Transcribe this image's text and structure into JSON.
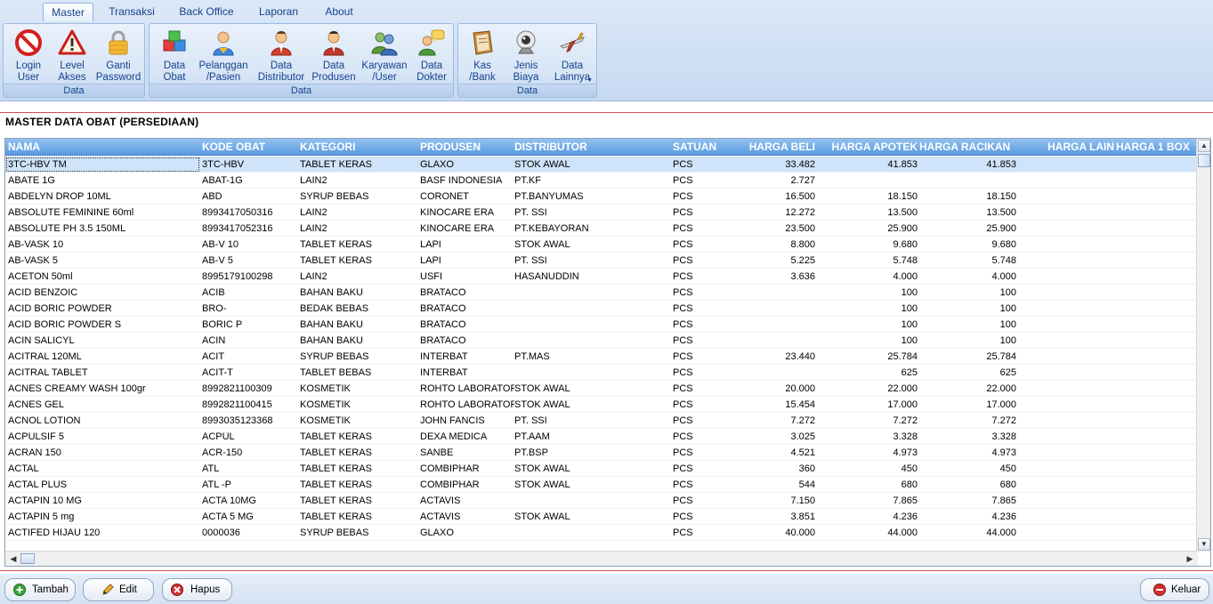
{
  "ribbon": {
    "tabs": [
      {
        "label": "Master",
        "active": true
      },
      {
        "label": "Transaksi",
        "active": false
      },
      {
        "label": "Back Office",
        "active": false
      },
      {
        "label": "Laporan",
        "active": false
      },
      {
        "label": "About",
        "active": false
      }
    ],
    "groups": [
      {
        "label": "Data",
        "buttons": [
          {
            "label": "Login\nUser",
            "icon": "no-entry-icon"
          },
          {
            "label": "Level\nAkses",
            "icon": "warning-icon"
          },
          {
            "label": "Ganti\nPassword",
            "icon": "padlock-icon"
          }
        ]
      },
      {
        "label": "Data",
        "buttons": [
          {
            "label": "Data\nObat",
            "icon": "cubes-icon"
          },
          {
            "label": "Pelanggan\n/Pasien",
            "icon": "customer-icon"
          },
          {
            "label": "Data\nDistributor",
            "icon": "distributor-person-icon"
          },
          {
            "label": "Data\nProdusen",
            "icon": "producer-person-icon"
          },
          {
            "label": "Karyawan\n/User",
            "icon": "users-group-icon"
          },
          {
            "label": "Data\nDokter",
            "icon": "doctor-chat-icon"
          }
        ]
      },
      {
        "label": "Data",
        "buttons": [
          {
            "label": "Kas\n/Bank",
            "icon": "book-icon"
          },
          {
            "label": "Jenis\nBiaya",
            "icon": "webcam-icon"
          },
          {
            "label": "Data\nLainnya",
            "icon": "airplane-icon",
            "dropdown": true
          }
        ]
      }
    ]
  },
  "page_title": "MASTER DATA OBAT (PERSEDIAAN)",
  "table": {
    "columns": [
      "NAMA",
      "KODE OBAT",
      "KATEGORI",
      "PRODUSEN",
      "DISTRIBUTOR",
      "SATUAN",
      "HARGA BELI",
      "HARGA APOTEK",
      "HARGA RACIKAN",
      "HARGA LAIN",
      "HARGA 1 BOX"
    ],
    "rows": [
      [
        "3TC-HBV TM",
        "3TC-HBV",
        "TABLET KERAS",
        "GLAXO",
        "STOK AWAL",
        "PCS",
        "33.482",
        "41.853",
        "41.853"
      ],
      [
        "ABATE 1G",
        "ABAT-1G",
        "LAIN2",
        "BASF INDONESIA",
        "PT.KF",
        "PCS",
        "2.727",
        "",
        ""
      ],
      [
        "ABDELYN DROP 10ML",
        "ABD",
        "SYRUP BEBAS",
        "CORONET",
        "PT.BANYUMAS",
        "PCS",
        "16.500",
        "18.150",
        "18.150"
      ],
      [
        "ABSOLUTE FEMININE 60ml",
        "8993417050316",
        "LAIN2",
        "KINOCARE ERA",
        "PT. SSI",
        "PCS",
        "12.272",
        "13.500",
        "13.500"
      ],
      [
        "ABSOLUTE PH 3.5 150ML",
        "8993417052316",
        "LAIN2",
        "KINOCARE ERA",
        "PT.KEBAYORAN",
        "PCS",
        "23.500",
        "25.900",
        "25.900"
      ],
      [
        "AB-VASK 10",
        "AB-V 10",
        "TABLET KERAS",
        "LAPI",
        "STOK AWAL",
        "PCS",
        "8.800",
        "9.680",
        "9.680"
      ],
      [
        "AB-VASK 5",
        "AB-V 5",
        "TABLET KERAS",
        "LAPI",
        "PT. SSI",
        "PCS",
        "5.225",
        "5.748",
        "5.748"
      ],
      [
        "ACETON 50ml",
        "8995179100298",
        "LAIN2",
        "USFI",
        "HASANUDDIN",
        "PCS",
        "3.636",
        "4.000",
        "4.000"
      ],
      [
        "ACID BENZOIC",
        "ACIB",
        "BAHAN BAKU",
        "BRATACO",
        "",
        "PCS",
        "",
        "100",
        "100"
      ],
      [
        "ACID BORIC POWDER",
        "BRO-",
        "BEDAK BEBAS",
        "BRATACO",
        "",
        "PCS",
        "",
        "100",
        "100"
      ],
      [
        "ACID BORIC POWDER S",
        "BORIC P",
        "BAHAN BAKU",
        "BRATACO",
        "",
        "PCS",
        "",
        "100",
        "100"
      ],
      [
        "ACIN SALICYL",
        "ACIN",
        "BAHAN BAKU",
        "BRATACO",
        "",
        "PCS",
        "",
        "100",
        "100"
      ],
      [
        "ACITRAL 120ML",
        "ACIT",
        "SYRUP BEBAS",
        "INTERBAT",
        "PT.MAS",
        "PCS",
        "23.440",
        "25.784",
        "25.784"
      ],
      [
        "ACITRAL TABLET",
        "ACIT-T",
        "TABLET BEBAS",
        "INTERBAT",
        "",
        "PCS",
        "",
        "625",
        "625"
      ],
      [
        "ACNES CREAMY WASH 100gr",
        "8992821100309",
        "KOSMETIK",
        "ROHTO LABORATOR",
        "STOK AWAL",
        "PCS",
        "20.000",
        "22.000",
        "22.000"
      ],
      [
        "ACNES GEL",
        "8992821100415",
        "KOSMETIK",
        "ROHTO LABORATOR",
        "STOK AWAL",
        "PCS",
        "15.454",
        "17.000",
        "17.000"
      ],
      [
        "ACNOL LOTION",
        "8993035123368",
        "KOSMETIK",
        "JOHN FANCIS",
        "PT. SSI",
        "PCS",
        "7.272",
        "7.272",
        "7.272"
      ],
      [
        "ACPULSIF 5",
        "ACPUL",
        "TABLET KERAS",
        "DEXA MEDICA",
        "PT.AAM",
        "PCS",
        "3.025",
        "3.328",
        "3.328"
      ],
      [
        "ACRAN 150",
        "ACR-150",
        "TABLET KERAS",
        "SANBE",
        "PT.BSP",
        "PCS",
        "4.521",
        "4.973",
        "4.973"
      ],
      [
        "ACTAL",
        "ATL",
        "TABLET KERAS",
        "COMBIPHAR",
        "STOK AWAL",
        "PCS",
        "360",
        "450",
        "450"
      ],
      [
        "ACTAL PLUS",
        "ATL -P",
        "TABLET KERAS",
        "COMBIPHAR",
        "STOK AWAL",
        "PCS",
        "544",
        "680",
        "680"
      ],
      [
        "ACTAPIN 10 MG",
        "ACTA 10MG",
        "TABLET KERAS",
        "ACTAVIS",
        "",
        "PCS",
        "7.150",
        "7.865",
        "7.865"
      ],
      [
        "ACTAPIN 5 mg",
        "ACTA 5 MG",
        "TABLET KERAS",
        "ACTAVIS",
        "STOK AWAL",
        "PCS",
        "3.851",
        "4.236",
        "4.236"
      ],
      [
        "ACTIFED HIJAU 120",
        "0000036",
        "SYRUP BEBAS",
        "GLAXO",
        "",
        "PCS",
        "40.000",
        "44.000",
        "44.000"
      ]
    ],
    "selected_row": 0
  },
  "footer": {
    "tambah": "Tambah",
    "edit": "Edit",
    "hapus": "Hapus",
    "keluar": "Keluar"
  },
  "colors": {
    "header_gradient_top": "#93c1f0",
    "header_gradient_bottom": "#5a9ae0",
    "accent_red": "#d05050",
    "ribbon_text": "#15428b"
  }
}
